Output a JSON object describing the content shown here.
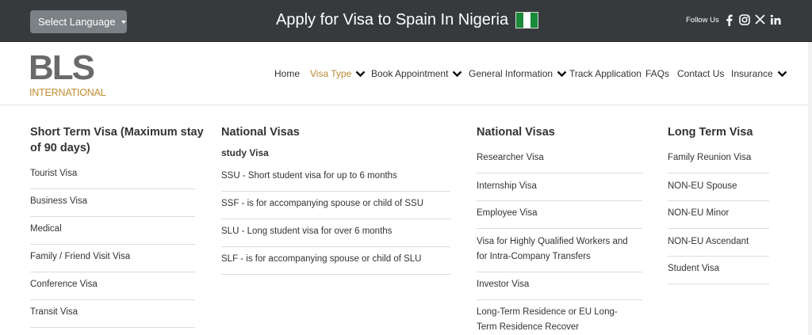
{
  "topbar": {
    "language_label": "Select Language",
    "title": "Apply for Visa to Spain In Nigeria",
    "follow_label": "Follow Us",
    "socials": [
      "facebook-icon",
      "instagram-icon",
      "x-icon",
      "linkedin-icon"
    ]
  },
  "logo": {
    "main": "BLS",
    "sub": "INTERNATIONAL"
  },
  "nav": {
    "home": "Home",
    "visa_type": "Visa Type",
    "book_appointment": "Book Appointment",
    "general_information": "General Information",
    "track_application": "Track Application",
    "faqs": "FAQs",
    "contact_us": "Contact Us",
    "insurance": "Insurance"
  },
  "columns": {
    "short_term": {
      "heading": "Short Term Visa (Maximum stay of 90 days)",
      "items": [
        "Tourist Visa",
        "Business Visa",
        "Medical",
        "Family / Friend Visit Visa",
        "Conference Visa",
        "Transit Visa"
      ]
    },
    "national_study": {
      "heading": "National Visas",
      "subheading": "study Visa",
      "items": [
        "SSU - Short student visa for up to 6 months",
        "SSF - is for accompanying spouse or child of SSU",
        "SLU - Long student visa for over 6 months",
        "SLF - is for accompanying spouse or child of SLU"
      ]
    },
    "national_work": {
      "heading": "National Visas",
      "items": [
        "Researcher Visa",
        "Internship Visa",
        "Employee Visa",
        "Visa for Highly Qualified Workers and for Intra-Company Transfers",
        "Investor Visa",
        "Long-Term Residence or EU Long-Term Residence Recover"
      ]
    },
    "long_term": {
      "heading": "Long Term Visa",
      "items": [
        "Family Reunion Visa",
        "NON-EU Spouse",
        "NON-EU Minor",
        "NON-EU Ascendant",
        "Student Visa"
      ]
    }
  },
  "colors": {
    "topbar": "#373a3c",
    "accent": "#b98a34",
    "text": "#333333"
  }
}
